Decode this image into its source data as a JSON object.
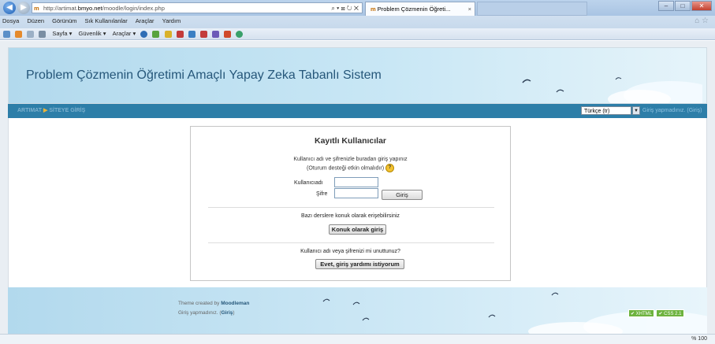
{
  "browser": {
    "url_prefix": "http://artimat.",
    "url_domain": "bmyo.net",
    "url_path": "/moodle/login/index.php",
    "address_controls": "⌕ ▾ ⊠ ↻ ✕",
    "tab_active": "Problem Çözmenin Öğreti...",
    "tab_close": "×",
    "tab_favicon": "m",
    "menu": [
      "Dosya",
      "Düzen",
      "Görünüm",
      "Sık Kullanılanlar",
      "Araçlar",
      "Yardım"
    ],
    "commands": [
      "Sayfa ▾",
      "Güvenlik ▾",
      "Araçlar ▾"
    ],
    "window_controls": [
      "–",
      "□",
      "✕"
    ],
    "zoom": "% 100"
  },
  "site": {
    "title": "Problem Çözmenin Öğretimi Amaçlı Yapay Zeka Tabanlı Sistem",
    "breadcrumb": [
      "ARTIMAT",
      "SİTEYE GİRİŞ"
    ],
    "breadcrumb_sep": "▶",
    "language": "Türkçe (tr)",
    "login_status": "Giriş yapmadınız. (Giriş)"
  },
  "login": {
    "heading": "Kayıtlı Kullanıcılar",
    "desc_line1": "Kullanıcı adı ve şifrenizle buradan giriş yapınız",
    "desc_line2": "(Oturum desteği etkin olmalıdır)",
    "help_glyph": "?",
    "username_label": "Kullanıcıadı",
    "password_label": "Şifre",
    "login_button": "Giriş",
    "guest_text": "Bazı derslere konuk olarak erişebilirsiniz",
    "guest_button": "Konuk olarak giriş",
    "forgot_text": "Kullanıcı adı veya şifrenizi mi unuttunuz?",
    "help_button": "Evet, giriş yardımı istiyorum"
  },
  "footer": {
    "credit_prefix": "Theme created by ",
    "credit_name": "Moodleman",
    "status_prefix": "Giriş yapmadınız. (",
    "status_link": "Giriş",
    "status_suffix": ")",
    "badge_xhtml": "✔ XHTML",
    "badge_css": "✔ CSS 2.1"
  }
}
